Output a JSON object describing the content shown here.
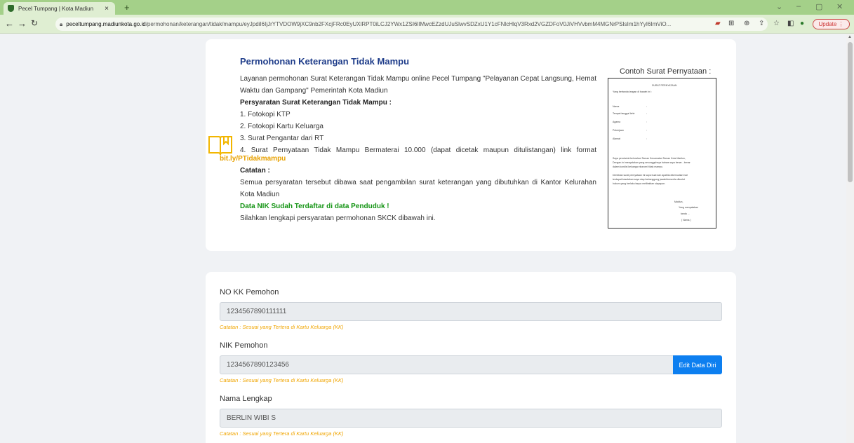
{
  "browser": {
    "tab_title": "Pecel Tumpang | Kota Madiun",
    "tab_close": "×",
    "new_tab": "+",
    "url_host": "peceltumpang.madiunkota.go.id",
    "url_path": "/permohonan/keterangan/tidak/mampu/eyJpdiI6IjJrYTVDOW9jXC9nb2FXcjFRc0EyUXlRPT0iLCJ2YWx1ZSI6IlMwcEZzdUJuSlwvSDZxU1Y1cFNlcHlqV3Rxd2VGZDFoV0JiVHVvbmM4MGNrPSIsIm1hYyI6ImViO...",
    "update_label": "Update"
  },
  "intro": {
    "title": "Permohonan Keterangan Tidak Mampu",
    "description": "Layanan permohonan Surat Keterangan Tidak Mampu online Pecel Tumpang \"Pelayanan Cepat Langsung, Hemat Waktu dan Gampang\" Pemerintah Kota Madiun",
    "requirements_heading": "Persyaratan Surat Keterangan Tidak Mampu :",
    "requirements": [
      "1. Fotokopi KTP",
      "2. Fotokopi Kartu Keluarga",
      "3. Surat Pengantar dari RT",
      "4. Surat Pernyataan Tidak Mampu Bermaterai 10.000 (dapat dicetak maupun ditulistangan) link format"
    ],
    "link": "bit.ly/PTidakmampu",
    "note_heading": "Catatan :",
    "note_text": "Semua persyaratan tersebut dibawa saat pengambilan surat keterangan yang dibutuhkan di Kantor Kelurahan Kota Madiun",
    "nik_status": "Data NIK Sudah Terdaftar di data Penduduk !",
    "instruction": "Silahkan lengkapi persyaratan permohonan SKCK dibawah ini.",
    "sample_title": "Contoh Surat Pernyataan :"
  },
  "letter": {
    "title": "SURAT PERNYATAAN",
    "intro": "Yang bertanda tangan di bawah ini :",
    "fields": [
      "Nama",
      "Tempat tanggal lahir",
      "Agama",
      "Pekerjaan",
      "Alamat"
    ],
    "body1": "Saya penduduk kelurahan Taman Kecamatan Taman Kota Madiun,",
    "body2": "Dengan ini menyatakan yang sesungguhnya bahwa saya benar - benar",
    "body3": "dalam kondisi keluarga ekonomi tidak mampu.",
    "body4": "Demikian surat pernyataan ini saya buat dan apabila dikemudian hari",
    "body5": "terdapat kesalahan saya siap bertanggung jawab/bersedia dituntut",
    "body6": "hukum yang berlaku tanpa melibatkan siapapun.",
    "place": "Madiun,",
    "signer": "Yang menyatakan",
    "stamp": "tanda ... ",
    "sign": "( Nama )"
  },
  "form": {
    "no_kk_label": "NO KK Pemohon",
    "no_kk_value": "1234567890111111",
    "nik_label": "NIK Pemohon",
    "nik_value": "1234567890123456",
    "edit_label": "Edit Data Diri",
    "nama_label": "Nama Lengkap",
    "nama_value": "BERLIN WIBI S",
    "field_note": "Catatan : Sesuai yang Tertera di Kartu Keluarga (KK)"
  }
}
